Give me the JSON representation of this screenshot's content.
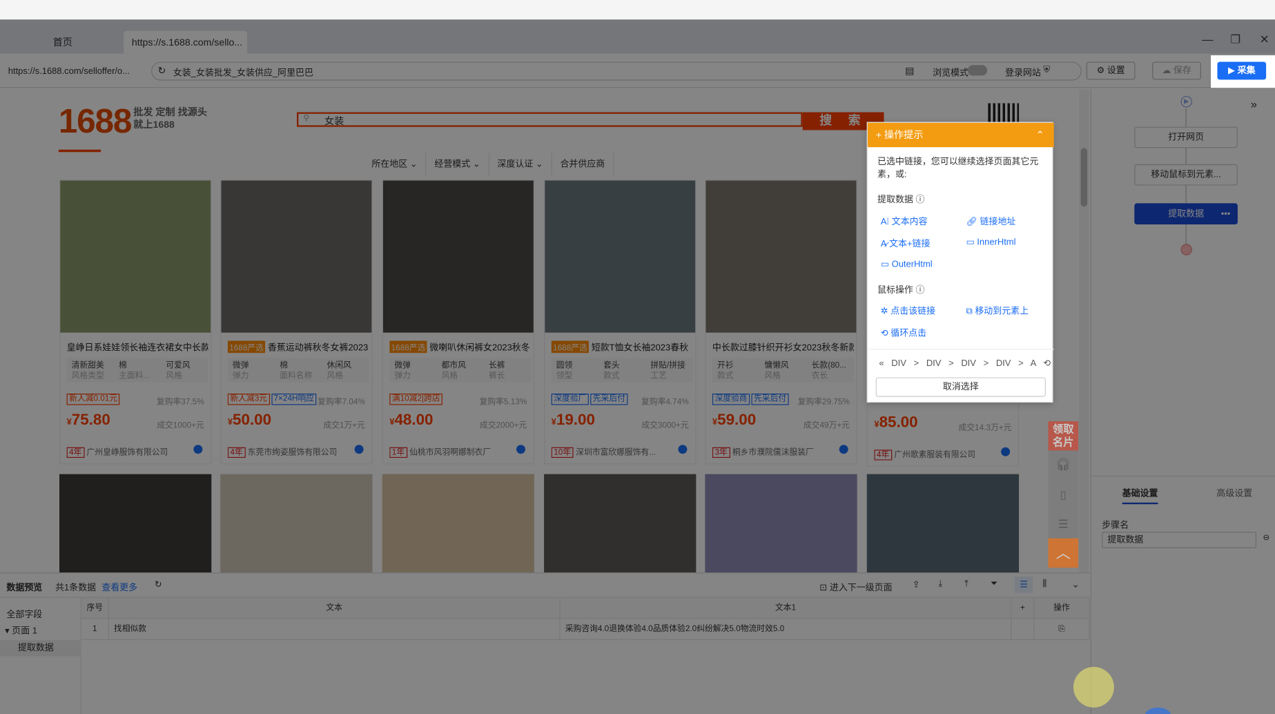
{
  "browser": {
    "tabs": [
      {
        "label": "首页"
      },
      {
        "label": "https://s.1688.com/sello..."
      }
    ],
    "url_short": "https://s.1688.com/selloffer/o...",
    "omnibox_text": "女装_女装批发_女装供应_阿里巴巴",
    "browse_mode_label": "浏览模式",
    "login_site_label": "登录网站",
    "settings_label": "设置",
    "save_label": "保存",
    "collect_label": "采集"
  },
  "site": {
    "logo": "1688",
    "slogan_line1": "批发 定制 找源头",
    "slogan_line2": "就上1688",
    "search_value": "女装",
    "search_button": "搜 索",
    "filters": [
      "所在地区",
      "经营模式",
      "深度认证",
      "合并供应商"
    ]
  },
  "products": [
    {
      "title": "皇峥日系娃娃领长袖连衣裙女中长款",
      "tag": "",
      "attrs": [
        [
          "清新甜美",
          "风格类型"
        ],
        [
          "棉",
          "主面料..."
        ],
        [
          "可爱风",
          "风格"
        ]
      ],
      "promos": [
        {
          "t": "新人减0.01元",
          "c": "red"
        }
      ],
      "rebuy": "复购率37.5%",
      "price": "75.80",
      "sold": "成交1000+元",
      "years": "4年",
      "shop": "广州皇峥服饰有限公司",
      "img": "#8a9a6a"
    },
    {
      "title": "香蕉运动裤秋冬女裤2023",
      "tag": "1688严选",
      "attrs": [
        [
          "微弹",
          "弹力"
        ],
        [
          "棉",
          "面料名称"
        ],
        [
          "休闲风",
          "风格"
        ]
      ],
      "promos": [
        {
          "t": "新人减3元",
          "c": "red"
        },
        {
          "t": "7×24H响应",
          "c": "blue"
        }
      ],
      "rebuy": "复购率7.04%",
      "price": "50.00",
      "sold": "成交1万+元",
      "years": "4年",
      "shop": "东莞市绚姿服饰有限公司",
      "img": "#6e6a66"
    },
    {
      "title": "微喇叭休闲裤女2023秋冬",
      "tag": "1688严选",
      "attrs": [
        [
          "微弹",
          "弹力"
        ],
        [
          "都市风",
          "风格"
        ],
        [
          "长裤",
          "裤长"
        ]
      ],
      "promos": [
        {
          "t": "满10减2|跨店",
          "c": "red"
        }
      ],
      "rebuy": "复购率5.13%",
      "price": "48.00",
      "sold": "成交2000+元",
      "years": "1年",
      "shop": "仙桃市风羽啊娜制衣厂",
      "img": "#4d4a48"
    },
    {
      "title": "短款T恤女长袖2023春秋",
      "tag": "1688严选",
      "attrs": [
        [
          "圆领",
          "领型"
        ],
        [
          "套头",
          "款式"
        ],
        [
          "拼贴/拼接",
          "工艺"
        ]
      ],
      "promos": [
        {
          "t": "深度验厂",
          "c": "blue"
        },
        {
          "t": "先采后付",
          "c": "blue"
        }
      ],
      "rebuy": "复购率4.74%",
      "price": "19.00",
      "sold": "成交3000+元",
      "years": "10年",
      "shop": "深圳市富欣娜服饰有...",
      "img": "#6b7a80"
    },
    {
      "title": "中长款过膝针织开衫女2023秋冬新款",
      "tag": "",
      "attrs": [
        [
          "开衫",
          "款式"
        ],
        [
          "慵懒风",
          "风格"
        ],
        [
          "长款(80...",
          "衣长"
        ]
      ],
      "promos": [
        {
          "t": "深度验商",
          "c": "blue"
        },
        {
          "t": "先采后付",
          "c": "blue"
        }
      ],
      "rebuy": "复购率29.75%",
      "price": "59.00",
      "sold": "成交49万+元",
      "years": "3年",
      "shop": "桐乡市濮院儒沫服装厂",
      "img": "#7d7770"
    },
    {
      "title": "",
      "tag": "",
      "attrs": [],
      "promos": [],
      "rebuy": "",
      "price": "85.00",
      "sold": "成交14.3万+元",
      "years": "4年",
      "shop": "广州歌素服装有限公司",
      "img": "#ffffff"
    }
  ],
  "row2_images": [
    "#3f3c3a",
    "#cfc6b6",
    "#d9c3a6",
    "#5c5a58",
    "#8f8cb8",
    "#5b6a78"
  ],
  "popup": {
    "title": "操作提示",
    "desc": "已选中链接，您可以继续选择页面其它元素，或:",
    "extract_title": "提取数据",
    "extract_items": [
      "文本内容",
      "链接地址",
      "文本+链接",
      "InnerHtml",
      "OuterHtml"
    ],
    "mouse_title": "鼠标操作",
    "mouse_items": [
      "点击该链接",
      "移动到元素上",
      "循环点击"
    ],
    "crumbs": "DIV > DIV > DIV > DIV > A",
    "cancel": "取消选择"
  },
  "side_card": "领取名片",
  "flow": {
    "nodes": [
      "打开网页",
      "移动鼠标到元素...",
      "提取数据"
    ],
    "tabs": [
      "基础设置",
      "高级设置"
    ],
    "step_name_label": "步骤名",
    "step_name_value": "提取数据"
  },
  "preview": {
    "title": "数据预览",
    "count": "共1条数据",
    "more": "查看更多",
    "next_page": "进入下一级页面",
    "all_fields": "全部字段",
    "page1": "页面 1",
    "extract": "提取数据",
    "headers": [
      "序号",
      "文本",
      "文本1",
      "+",
      "操作"
    ],
    "rows": [
      [
        "1",
        "找相似款",
        "采购咨询4.0退换体验4.0品质体验2.0纠纷解决5.0物流时效5.0"
      ]
    ]
  }
}
